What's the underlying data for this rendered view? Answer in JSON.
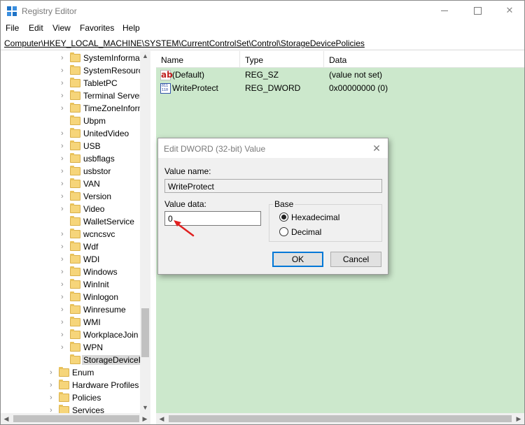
{
  "window": {
    "title": "Registry Editor",
    "controls": {
      "minimize": "",
      "maximize": "",
      "close": "✕"
    }
  },
  "menu": [
    "File",
    "Edit",
    "View",
    "Favorites",
    "Help"
  ],
  "address": "Computer\\HKEY_LOCAL_MACHINE\\SYSTEM\\CurrentControlSet\\Control\\StorageDevicePolicies",
  "tree": {
    "items": [
      {
        "label": "SystemInformation",
        "depth": 1,
        "expandable": true
      },
      {
        "label": "SystemResources",
        "depth": 1,
        "expandable": true
      },
      {
        "label": "TabletPC",
        "depth": 1,
        "expandable": true
      },
      {
        "label": "Terminal Server",
        "depth": 1,
        "expandable": true
      },
      {
        "label": "TimeZoneInformation",
        "depth": 1,
        "expandable": true
      },
      {
        "label": "Ubpm",
        "depth": 1,
        "expandable": false
      },
      {
        "label": "UnitedVideo",
        "depth": 1,
        "expandable": true
      },
      {
        "label": "USB",
        "depth": 1,
        "expandable": true
      },
      {
        "label": "usbflags",
        "depth": 1,
        "expandable": true
      },
      {
        "label": "usbstor",
        "depth": 1,
        "expandable": true
      },
      {
        "label": "VAN",
        "depth": 1,
        "expandable": true
      },
      {
        "label": "Version",
        "depth": 1,
        "expandable": true
      },
      {
        "label": "Video",
        "depth": 1,
        "expandable": true
      },
      {
        "label": "WalletService",
        "depth": 1,
        "expandable": false
      },
      {
        "label": "wcncsvc",
        "depth": 1,
        "expandable": true
      },
      {
        "label": "Wdf",
        "depth": 1,
        "expandable": true
      },
      {
        "label": "WDI",
        "depth": 1,
        "expandable": true
      },
      {
        "label": "Windows",
        "depth": 1,
        "expandable": true
      },
      {
        "label": "WinInit",
        "depth": 1,
        "expandable": true
      },
      {
        "label": "Winlogon",
        "depth": 1,
        "expandable": true
      },
      {
        "label": "Winresume",
        "depth": 1,
        "expandable": true
      },
      {
        "label": "WMI",
        "depth": 1,
        "expandable": true
      },
      {
        "label": "WorkplaceJoin",
        "depth": 1,
        "expandable": true
      },
      {
        "label": "WPN",
        "depth": 1,
        "expandable": true
      },
      {
        "label": "StorageDevicePolicies",
        "depth": 1,
        "expandable": false,
        "selected": true
      },
      {
        "label": "Enum",
        "depth": 0,
        "expandable": true
      },
      {
        "label": "Hardware Profiles",
        "depth": 0,
        "expandable": true
      },
      {
        "label": "Policies",
        "depth": 0,
        "expandable": true
      },
      {
        "label": "Services",
        "depth": 0,
        "expandable": true
      }
    ]
  },
  "list": {
    "columns": [
      "Name",
      "Type",
      "Data"
    ],
    "rows": [
      {
        "icon": "string-value-icon",
        "name": "(Default)",
        "type": "REG_SZ",
        "data": "(value not set)"
      },
      {
        "icon": "binary-value-icon",
        "name": "WriteProtect",
        "type": "REG_DWORD",
        "data": "0x00000000 (0)"
      }
    ]
  },
  "dialog": {
    "title": "Edit DWORD (32-bit) Value",
    "value_name_label": "Value name:",
    "value_name": "WriteProtect",
    "value_data_label": "Value data:",
    "value_data": "0",
    "base_label": "Base",
    "base_options": [
      "Hexadecimal",
      "Decimal"
    ],
    "base_selected": "Hexadecimal",
    "ok_label": "OK",
    "cancel_label": "Cancel"
  },
  "colors": {
    "list_background": "#cce8cc",
    "annotation_arrow": "#e02020",
    "ok_border": "#0078d7"
  }
}
